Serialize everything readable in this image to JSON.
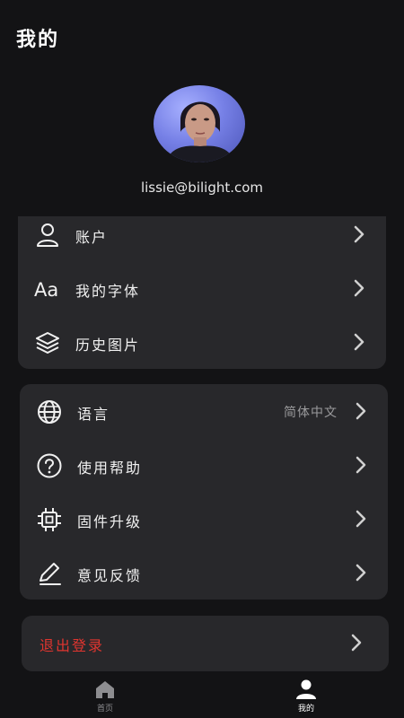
{
  "header": {
    "title": "我的"
  },
  "profile": {
    "email": "lissie@bilight.com"
  },
  "menu_group_1": [
    {
      "label": "账户",
      "icon": "user-icon"
    },
    {
      "label": "我的字体",
      "icon": "font-icon"
    },
    {
      "label": "历史图片",
      "icon": "layers-icon"
    }
  ],
  "menu_group_2": [
    {
      "label": "语言",
      "value": "简体中文",
      "icon": "globe-icon"
    },
    {
      "label": "使用帮助",
      "icon": "help-icon"
    },
    {
      "label": "固件升级",
      "icon": "chip-icon"
    },
    {
      "label": "意见反馈",
      "icon": "pen-icon"
    }
  ],
  "logout": {
    "label": "退出登录",
    "color": "#e0352f"
  },
  "tabbar": {
    "home_label": "首页",
    "mine_label": "我的"
  },
  "colors": {
    "background": "#131315",
    "card": "#28282b",
    "text": "#f1f1f1",
    "muted": "#9a9a9c",
    "danger": "#e0352f"
  }
}
